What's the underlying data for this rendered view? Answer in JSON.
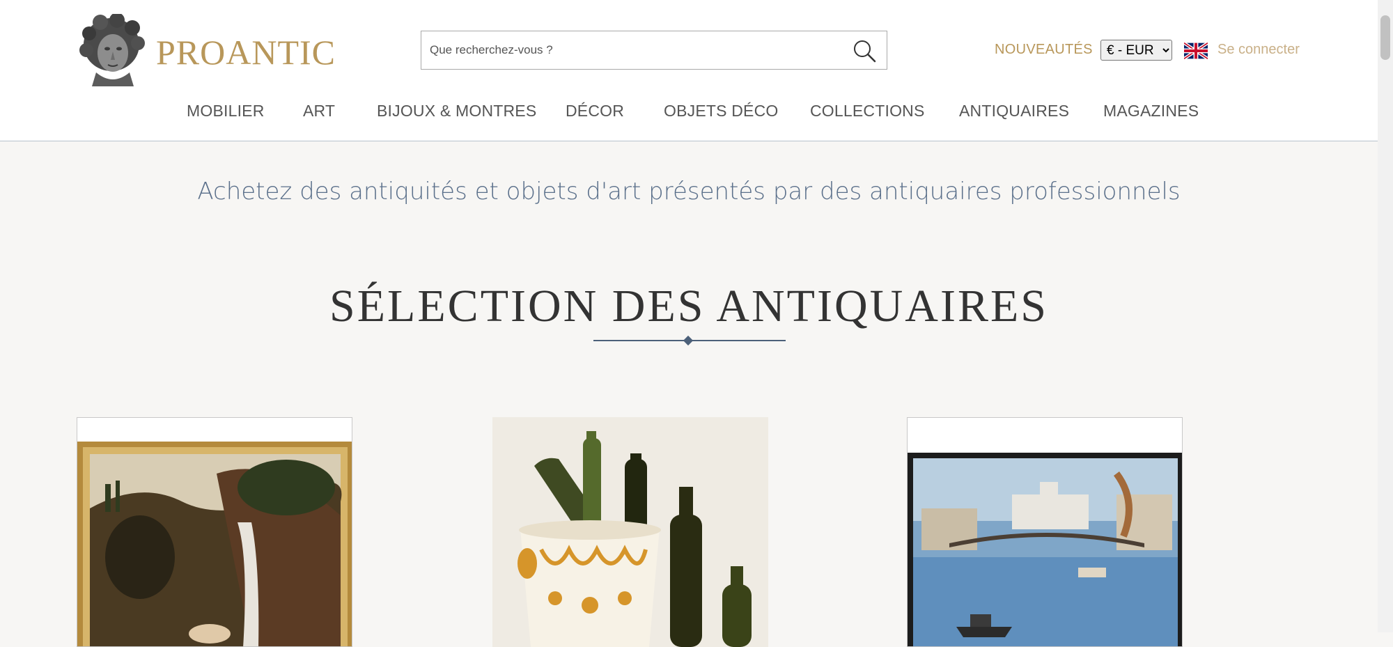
{
  "header": {
    "logo_text": "PROANTIC",
    "search": {
      "placeholder": "Que recherchez-vous ?"
    },
    "nouveautes_label": "NOUVEAUTÉS",
    "currency": {
      "selected": "€ - EUR"
    },
    "language_flag_icon": "uk-flag-icon",
    "login_label": "Se connecter",
    "nav": [
      {
        "label": "MOBILIER"
      },
      {
        "label": "ART"
      },
      {
        "label": "BIJOUX & MONTRES"
      },
      {
        "label": "DÉCOR"
      },
      {
        "label": "OBJETS DÉCO"
      },
      {
        "label": "COLLECTIONS"
      },
      {
        "label": "ANTIQUAIRES"
      },
      {
        "label": "MAGAZINES"
      }
    ]
  },
  "main": {
    "tagline": "Achetez des antiquités et objets d'art présentés par des antiquaires professionnels",
    "section_title": "SÉLECTION DES ANTIQUAIRES"
  },
  "colors": {
    "accent_gold": "#b8975a",
    "accent_blue": "#4c6079",
    "page_background": "#f7f6f4"
  }
}
